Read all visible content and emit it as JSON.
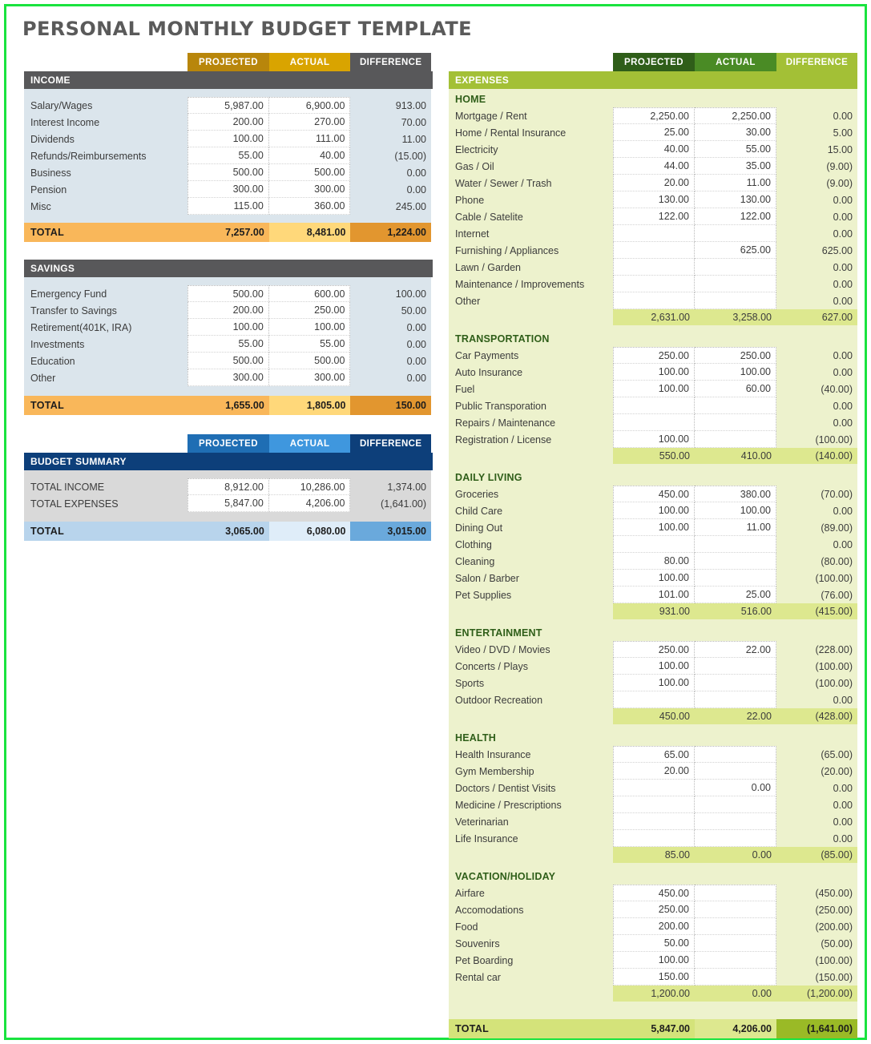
{
  "page": {
    "title": "PERSONAL MONTHLY BUDGET TEMPLATE",
    "border_color": "#19e33f"
  },
  "colors": {
    "income_header_projected": "#b8860b",
    "income_header_actual": "#d9a400",
    "income_header_difference": "#58585a",
    "income_band": "#58585a",
    "income_body": "#dbe5ec",
    "income_total_projected": "#f9b75a",
    "income_total_actual": "#ffd87a",
    "income_total_difference": "#e2962f",
    "summary_header_projected": "#1f6eb4",
    "summary_header_actual": "#3f97de",
    "summary_header_difference": "#0d3f7a",
    "summary_band": "#0d3f7a",
    "summary_body": "#d9d9d9",
    "summary_total_projected": "#b8d4ec",
    "summary_total_actual": "#dfedf9",
    "summary_total_difference": "#6aa9dc",
    "expense_header_projected": "#2f5e19",
    "expense_header_actual": "#4a8b25",
    "expense_header_difference": "#a3c036",
    "expense_band": "#a3c036",
    "expense_body": "#edf2cd",
    "expense_subtotal": "#dde88f",
    "expense_total_projected": "#d4e37a",
    "expense_total_actual": "#dde88f",
    "expense_total_difference": "#9aba26"
  },
  "income": {
    "band_label": "INCOME",
    "columns": [
      "PROJECTED",
      "ACTUAL",
      "DIFFERENCE"
    ],
    "rows": [
      {
        "label": "Salary/Wages",
        "projected": "5,987.00",
        "actual": "6,900.00",
        "difference": "913.00"
      },
      {
        "label": "Interest Income",
        "projected": "200.00",
        "actual": "270.00",
        "difference": "70.00"
      },
      {
        "label": "Dividends",
        "projected": "100.00",
        "actual": "111.00",
        "difference": "11.00"
      },
      {
        "label": "Refunds/Reimbursements",
        "projected": "55.00",
        "actual": "40.00",
        "difference": "(15.00)"
      },
      {
        "label": "Business",
        "projected": "500.00",
        "actual": "500.00",
        "difference": "0.00"
      },
      {
        "label": "Pension",
        "projected": "300.00",
        "actual": "300.00",
        "difference": "0.00"
      },
      {
        "label": "Misc",
        "projected": "115.00",
        "actual": "360.00",
        "difference": "245.00"
      }
    ],
    "total": {
      "label": "TOTAL",
      "projected": "7,257.00",
      "actual": "8,481.00",
      "difference": "1,224.00"
    }
  },
  "savings": {
    "band_label": "SAVINGS",
    "rows": [
      {
        "label": "Emergency Fund",
        "projected": "500.00",
        "actual": "600.00",
        "difference": "100.00"
      },
      {
        "label": "Transfer to Savings",
        "projected": "200.00",
        "actual": "250.00",
        "difference": "50.00"
      },
      {
        "label": "Retirement(401K, IRA)",
        "projected": "100.00",
        "actual": "100.00",
        "difference": "0.00"
      },
      {
        "label": "Investments",
        "projected": "55.00",
        "actual": "55.00",
        "difference": "0.00"
      },
      {
        "label": "Education",
        "projected": "500.00",
        "actual": "500.00",
        "difference": "0.00"
      },
      {
        "label": "Other",
        "projected": "300.00",
        "actual": "300.00",
        "difference": "0.00"
      }
    ],
    "total": {
      "label": "TOTAL",
      "projected": "1,655.00",
      "actual": "1,805.00",
      "difference": "150.00"
    }
  },
  "budget_summary": {
    "band_label": "BUDGET SUMMARY",
    "columns": [
      "PROJECTED",
      "ACTUAL",
      "DIFFERENCE"
    ],
    "rows": [
      {
        "label": "TOTAL INCOME",
        "projected": "8,912.00",
        "actual": "10,286.00",
        "difference": "1,374.00"
      },
      {
        "label": "TOTAL EXPENSES",
        "projected": "5,847.00",
        "actual": "4,206.00",
        "difference": "(1,641.00)"
      }
    ],
    "total": {
      "label": "TOTAL",
      "projected": "3,065.00",
      "actual": "6,080.00",
      "difference": "3,015.00"
    }
  },
  "expenses": {
    "band_label": "EXPENSES",
    "columns": [
      "PROJECTED",
      "ACTUAL",
      "DIFFERENCE"
    ],
    "groups": [
      {
        "name": "HOME",
        "rows": [
          {
            "label": "Mortgage / Rent",
            "projected": "2,250.00",
            "actual": "2,250.00",
            "difference": "0.00"
          },
          {
            "label": "Home / Rental Insurance",
            "projected": "25.00",
            "actual": "30.00",
            "difference": "5.00"
          },
          {
            "label": "Electricity",
            "projected": "40.00",
            "actual": "55.00",
            "difference": "15.00"
          },
          {
            "label": "Gas / Oil",
            "projected": "44.00",
            "actual": "35.00",
            "difference": "(9.00)"
          },
          {
            "label": "Water / Sewer / Trash",
            "projected": "20.00",
            "actual": "11.00",
            "difference": "(9.00)"
          },
          {
            "label": "Phone",
            "projected": "130.00",
            "actual": "130.00",
            "difference": "0.00"
          },
          {
            "label": "Cable / Satelite",
            "projected": "122.00",
            "actual": "122.00",
            "difference": "0.00"
          },
          {
            "label": "Internet",
            "projected": "",
            "actual": "",
            "difference": "0.00"
          },
          {
            "label": "Furnishing / Appliances",
            "projected": "",
            "actual": "625.00",
            "difference": "625.00"
          },
          {
            "label": "Lawn / Garden",
            "projected": "",
            "actual": "",
            "difference": "0.00"
          },
          {
            "label": "Maintenance / Improvements",
            "projected": "",
            "actual": "",
            "difference": "0.00"
          },
          {
            "label": "Other",
            "projected": "",
            "actual": "",
            "difference": "0.00"
          }
        ],
        "subtotal": {
          "projected": "2,631.00",
          "actual": "3,258.00",
          "difference": "627.00"
        }
      },
      {
        "name": "TRANSPORTATION",
        "rows": [
          {
            "label": "Car Payments",
            "projected": "250.00",
            "actual": "250.00",
            "difference": "0.00"
          },
          {
            "label": "Auto Insurance",
            "projected": "100.00",
            "actual": "100.00",
            "difference": "0.00"
          },
          {
            "label": "Fuel",
            "projected": "100.00",
            "actual": "60.00",
            "difference": "(40.00)"
          },
          {
            "label": "Public Transporation",
            "projected": "",
            "actual": "",
            "difference": "0.00"
          },
          {
            "label": "Repairs / Maintenance",
            "projected": "",
            "actual": "",
            "difference": "0.00"
          },
          {
            "label": "Registration / License",
            "projected": "100.00",
            "actual": "",
            "difference": "(100.00)"
          }
        ],
        "subtotal": {
          "projected": "550.00",
          "actual": "410.00",
          "difference": "(140.00)"
        }
      },
      {
        "name": "DAILY LIVING",
        "rows": [
          {
            "label": "Groceries",
            "projected": "450.00",
            "actual": "380.00",
            "difference": "(70.00)"
          },
          {
            "label": "Child Care",
            "projected": "100.00",
            "actual": "100.00",
            "difference": "0.00"
          },
          {
            "label": "Dining Out",
            "projected": "100.00",
            "actual": "11.00",
            "difference": "(89.00)"
          },
          {
            "label": "Clothing",
            "projected": "",
            "actual": "",
            "difference": "0.00"
          },
          {
            "label": "Cleaning",
            "projected": "80.00",
            "actual": "",
            "difference": "(80.00)"
          },
          {
            "label": "Salon / Barber",
            "projected": "100.00",
            "actual": "",
            "difference": "(100.00)"
          },
          {
            "label": "Pet Supplies",
            "projected": "101.00",
            "actual": "25.00",
            "difference": "(76.00)"
          }
        ],
        "subtotal": {
          "projected": "931.00",
          "actual": "516.00",
          "difference": "(415.00)"
        }
      },
      {
        "name": "ENTERTAINMENT",
        "rows": [
          {
            "label": "Video / DVD / Movies",
            "projected": "250.00",
            "actual": "22.00",
            "difference": "(228.00)"
          },
          {
            "label": "Concerts / Plays",
            "projected": "100.00",
            "actual": "",
            "difference": "(100.00)"
          },
          {
            "label": "Sports",
            "projected": "100.00",
            "actual": "",
            "difference": "(100.00)"
          },
          {
            "label": "Outdoor Recreation",
            "projected": "",
            "actual": "",
            "difference": "0.00"
          }
        ],
        "subtotal": {
          "projected": "450.00",
          "actual": "22.00",
          "difference": "(428.00)"
        }
      },
      {
        "name": "HEALTH",
        "rows": [
          {
            "label": "Health Insurance",
            "projected": "65.00",
            "actual": "",
            "difference": "(65.00)"
          },
          {
            "label": "Gym Membership",
            "projected": "20.00",
            "actual": "",
            "difference": "(20.00)"
          },
          {
            "label": "Doctors / Dentist Visits",
            "projected": "",
            "actual": "0.00",
            "difference": "0.00"
          },
          {
            "label": "Medicine / Prescriptions",
            "projected": "",
            "actual": "",
            "difference": "0.00"
          },
          {
            "label": "Veterinarian",
            "projected": "",
            "actual": "",
            "difference": "0.00"
          },
          {
            "label": "Life Insurance",
            "projected": "",
            "actual": "",
            "difference": "0.00"
          }
        ],
        "subtotal": {
          "projected": "85.00",
          "actual": "0.00",
          "difference": "(85.00)"
        }
      },
      {
        "name": "VACATION/HOLIDAY",
        "rows": [
          {
            "label": "Airfare",
            "projected": "450.00",
            "actual": "",
            "difference": "(450.00)"
          },
          {
            "label": "Accomodations",
            "projected": "250.00",
            "actual": "",
            "difference": "(250.00)"
          },
          {
            "label": "Food",
            "projected": "200.00",
            "actual": "",
            "difference": "(200.00)"
          },
          {
            "label": "Souvenirs",
            "projected": "50.00",
            "actual": "",
            "difference": "(50.00)"
          },
          {
            "label": "Pet Boarding",
            "projected": "100.00",
            "actual": "",
            "difference": "(100.00)"
          },
          {
            "label": "Rental car",
            "projected": "150.00",
            "actual": "",
            "difference": "(150.00)"
          }
        ],
        "subtotal": {
          "projected": "1,200.00",
          "actual": "0.00",
          "difference": "(1,200.00)"
        }
      }
    ],
    "total": {
      "label": "TOTAL",
      "projected": "5,847.00",
      "actual": "4,206.00",
      "difference": "(1,641.00)"
    }
  }
}
